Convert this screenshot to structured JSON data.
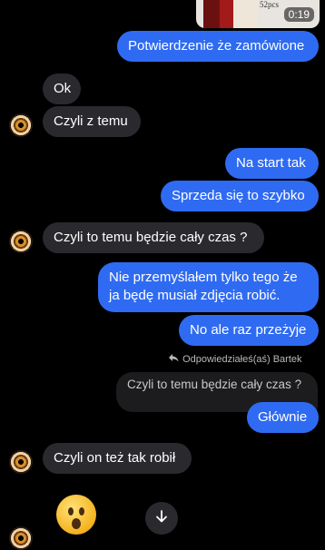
{
  "video": {
    "duration": "0:19",
    "thumb_label": "52pcs"
  },
  "messages": {
    "m1": "Potwierdzenie że zamówione",
    "m2": "Ok",
    "m3": "Czyli z temu",
    "m4": "Na start tak",
    "m5": "Sprzeda się to szybko",
    "m6": "Czyli to temu będzie cały czas ?",
    "m7_line1": "Nie przemyślałem tylko tego że",
    "m7_line2": "ja będę musiał zdjęcia robić.",
    "m8": "No ale raz przeżyje",
    "reply_label": "Odpowiedziałeś(aś) Bartek",
    "reply_quote": "Czyli to temu będzie cały czas ?",
    "m9": "Głównie",
    "m10": "Czyli on też tak robił"
  },
  "colors": {
    "outgoing": "#2f6bf2",
    "incoming": "#2a2a2e",
    "background": "#000000"
  },
  "icons": {
    "reply": "reply-arrow-icon",
    "scroll_down": "arrow-down-icon",
    "emoji": "surprised-face-emoji"
  }
}
